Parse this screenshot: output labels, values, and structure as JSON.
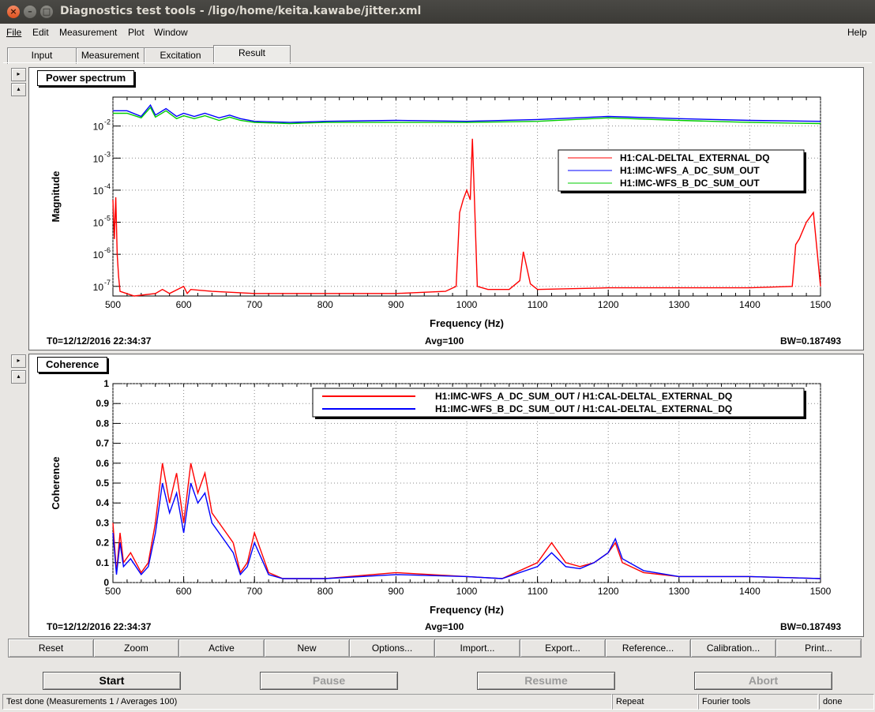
{
  "window": {
    "title": "Diagnostics test tools - /ligo/home/keita.kawabe/jitter.xml",
    "close_glyph": "×",
    "min_glyph": "–",
    "max_glyph": "□"
  },
  "menu": {
    "file": "File",
    "edit": "Edit",
    "measurement": "Measurement",
    "plot": "Plot",
    "window": "Window",
    "help": "Help"
  },
  "tabs": [
    "Input",
    "Measurement",
    "Excitation",
    "Result"
  ],
  "active_tab": "Result",
  "side_buttons": {
    "expand": "▸",
    "collapse": "▴"
  },
  "panels": {
    "power": {
      "label": "Power spectrum",
      "t0": "T0=12/12/2016 22:34:37",
      "avg": "Avg=100",
      "bw": "BW=0.187493"
    },
    "coherence": {
      "label": "Coherence",
      "t0": "T0=12/12/2016 22:34:37",
      "avg": "Avg=100",
      "bw": "BW=0.187493"
    }
  },
  "chart_data": [
    {
      "type": "line",
      "title": "Power spectrum",
      "xlabel": "Frequency (Hz)",
      "ylabel": "Magnitude",
      "xlim": [
        500,
        1500
      ],
      "ylim": [
        5e-08,
        0.08
      ],
      "yscale": "log",
      "grid": true,
      "legend_position": "top-right",
      "x_ticks": [
        "500",
        "600",
        "700",
        "800",
        "900",
        "1000",
        "1100",
        "1200",
        "1300",
        "1400",
        "1500"
      ],
      "y_ticks": [
        {
          "base": "10",
          "exp": "-2",
          "value": 0.01
        },
        {
          "base": "10",
          "exp": "-3",
          "value": 0.001
        },
        {
          "base": "10",
          "exp": "-4",
          "value": 0.0001
        },
        {
          "base": "10",
          "exp": "-5",
          "value": 1e-05
        },
        {
          "base": "10",
          "exp": "-6",
          "value": 1e-06
        },
        {
          "base": "10",
          "exp": "-7",
          "value": 1e-07
        }
      ],
      "series": [
        {
          "name": "H1:CAL-DELTAL_EXTERNAL_DQ",
          "color": "#ff0000",
          "x": [
            500,
            502,
            504,
            506,
            508,
            510,
            530,
            560,
            570,
            580,
            600,
            605,
            610,
            640,
            700,
            800,
            900,
            970,
            985,
            990,
            995,
            1000,
            1005,
            1008,
            1010,
            1015,
            1030,
            1060,
            1075,
            1080,
            1090,
            1100,
            1200,
            1300,
            1400,
            1460,
            1465,
            1470,
            1480,
            1490,
            1500
          ],
          "y": [
            5e-05,
            3e-06,
            6e-05,
            1e-06,
            2e-07,
            7e-08,
            5e-08,
            6e-08,
            8e-08,
            6e-08,
            1e-07,
            6e-08,
            8e-08,
            7e-08,
            6e-08,
            6e-08,
            6e-08,
            7e-08,
            1e-07,
            2e-05,
            5e-05,
            0.0001,
            5e-05,
            0.004,
            0.0002,
            1e-07,
            8e-08,
            8e-08,
            1.5e-07,
            1.2e-06,
            1.2e-07,
            8e-08,
            9e-08,
            9e-08,
            9e-08,
            1e-07,
            2e-06,
            3e-06,
            1e-05,
            2e-05,
            1e-07
          ]
        },
        {
          "name": "H1:IMC-WFS_A_DC_SUM_OUT",
          "color": "#0000ff",
          "x": [
            500,
            520,
            540,
            553,
            560,
            575,
            590,
            600,
            615,
            630,
            650,
            665,
            680,
            700,
            750,
            800,
            900,
            1000,
            1100,
            1200,
            1300,
            1400,
            1500
          ],
          "y": [
            0.03,
            0.03,
            0.02,
            0.045,
            0.022,
            0.035,
            0.02,
            0.025,
            0.02,
            0.025,
            0.018,
            0.022,
            0.017,
            0.014,
            0.013,
            0.014,
            0.015,
            0.014,
            0.016,
            0.02,
            0.017,
            0.015,
            0.014
          ]
        },
        {
          "name": "H1:IMC-WFS_B_DC_SUM_OUT",
          "color": "#00cc00",
          "x": [
            500,
            520,
            540,
            553,
            560,
            575,
            590,
            600,
            615,
            630,
            650,
            665,
            680,
            700,
            750,
            800,
            900,
            1000,
            1100,
            1200,
            1300,
            1400,
            1500
          ],
          "y": [
            0.025,
            0.025,
            0.018,
            0.038,
            0.019,
            0.03,
            0.017,
            0.021,
            0.017,
            0.021,
            0.015,
            0.019,
            0.015,
            0.013,
            0.012,
            0.013,
            0.013,
            0.013,
            0.014,
            0.018,
            0.015,
            0.013,
            0.012
          ]
        }
      ]
    },
    {
      "type": "line",
      "title": "Coherence",
      "xlabel": "Frequency (Hz)",
      "ylabel": "Coherence",
      "xlim": [
        500,
        1500
      ],
      "ylim": [
        0,
        1
      ],
      "grid": true,
      "legend_position": "top-right",
      "x_ticks": [
        "500",
        "600",
        "700",
        "800",
        "900",
        "1000",
        "1100",
        "1200",
        "1300",
        "1400",
        "1500"
      ],
      "y_ticks": [
        "0",
        "0.1",
        "0.2",
        "0.3",
        "0.4",
        "0.5",
        "0.6",
        "0.7",
        "0.8",
        "0.9",
        "1"
      ],
      "series": [
        {
          "name": "H1:IMC-WFS_A_DC_SUM_OUT / H1:CAL-DELTAL_EXTERNAL_DQ",
          "color": "#ff0000",
          "x": [
            500,
            505,
            510,
            515,
            525,
            540,
            550,
            560,
            570,
            580,
            590,
            600,
            610,
            620,
            630,
            640,
            650,
            660,
            670,
            680,
            690,
            700,
            710,
            720,
            740,
            800,
            900,
            1000,
            1050,
            1100,
            1120,
            1140,
            1160,
            1180,
            1200,
            1210,
            1220,
            1250,
            1300,
            1400,
            1500
          ],
          "y": [
            0.3,
            0.05,
            0.25,
            0.1,
            0.15,
            0.05,
            0.1,
            0.3,
            0.6,
            0.4,
            0.55,
            0.3,
            0.6,
            0.45,
            0.55,
            0.35,
            0.3,
            0.25,
            0.2,
            0.05,
            0.1,
            0.25,
            0.15,
            0.05,
            0.02,
            0.02,
            0.05,
            0.03,
            0.02,
            0.1,
            0.2,
            0.1,
            0.08,
            0.1,
            0.15,
            0.2,
            0.1,
            0.05,
            0.03,
            0.03,
            0.02
          ]
        },
        {
          "name": "H1:IMC-WFS_B_DC_SUM_OUT / H1:CAL-DELTAL_EXTERNAL_DQ",
          "color": "#0000ff",
          "x": [
            500,
            505,
            510,
            515,
            525,
            540,
            550,
            560,
            570,
            580,
            590,
            600,
            610,
            620,
            630,
            640,
            650,
            660,
            670,
            680,
            690,
            700,
            710,
            720,
            740,
            800,
            900,
            1000,
            1050,
            1100,
            1120,
            1140,
            1160,
            1180,
            1200,
            1210,
            1220,
            1250,
            1300,
            1400,
            1500
          ],
          "y": [
            0.25,
            0.04,
            0.2,
            0.08,
            0.12,
            0.04,
            0.08,
            0.25,
            0.5,
            0.35,
            0.45,
            0.25,
            0.5,
            0.4,
            0.45,
            0.3,
            0.25,
            0.2,
            0.15,
            0.04,
            0.08,
            0.2,
            0.12,
            0.04,
            0.02,
            0.02,
            0.04,
            0.03,
            0.02,
            0.08,
            0.15,
            0.08,
            0.07,
            0.1,
            0.15,
            0.22,
            0.12,
            0.06,
            0.03,
            0.03,
            0.02
          ]
        }
      ]
    }
  ],
  "toolbar": [
    "Reset",
    "Zoom",
    "Active",
    "New",
    "Options...",
    "Import...",
    "Export...",
    "Reference...",
    "Calibration...",
    "Print..."
  ],
  "controls": {
    "start": "Start",
    "pause": "Pause",
    "resume": "Resume",
    "abort": "Abort"
  },
  "statusbar": {
    "message": "Test done (Measurements 1 / Averages 100)",
    "mode": "Repeat",
    "tool": "Fourier tools",
    "state": "done"
  }
}
